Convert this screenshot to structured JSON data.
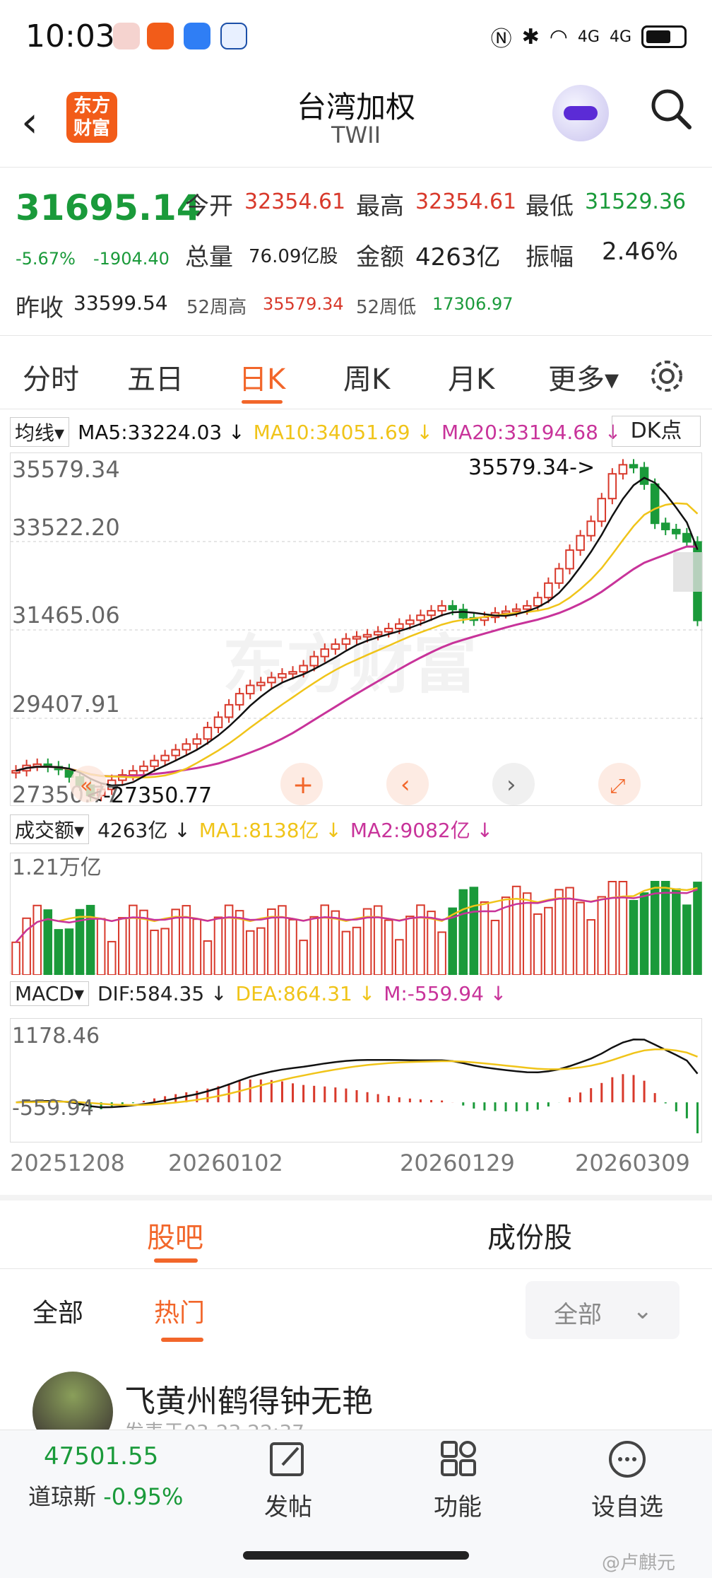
{
  "status_bar": {
    "time": "10:03",
    "signal_a": "4G",
    "signal_b": "4G"
  },
  "header": {
    "logo_line1": "东方",
    "logo_line2": "财富",
    "title": "台湾加权",
    "subtitle": "TWII"
  },
  "quote": {
    "price": "31695.14",
    "change_pct": "-5.67%",
    "change_abs": "-1904.40",
    "open_label": "今开",
    "open_value": "32354.61",
    "high_label": "最高",
    "high_value": "32354.61",
    "low_label": "最低",
    "low_value": "31529.36",
    "volume_label": "总量",
    "volume_value": "76.09亿股",
    "amount_label": "金额",
    "amount_value": "4263亿",
    "amplitude_label": "振幅",
    "amplitude_value": "2.46%",
    "prev_close_label": "昨收",
    "prev_close_value": "33599.54",
    "w52_high_label": "52周高",
    "w52_high_value": "35579.34",
    "w52_low_label": "52周低",
    "w52_low_value": "17306.97"
  },
  "tabs": [
    "分时",
    "五日",
    "日K",
    "周K",
    "月K",
    "更多▾"
  ],
  "active_tab": "日K",
  "ma_row": {
    "selector": "均线",
    "ma5": "MA5:33224.03 ↓",
    "ma10": "MA10:34051.69 ↓",
    "ma20": "MA20:33194.68 ↓",
    "dk_button": "DK点"
  },
  "price_axis": [
    "35579.34",
    "33522.20",
    "31465.06",
    "29407.91",
    "27350.77"
  ],
  "annotations": {
    "high": "35579.34->",
    "low": "<-27350.77"
  },
  "watermark_logo": "东方财富",
  "vol_row": {
    "selector": "成交额",
    "amount": "4263亿 ↓",
    "ma1": "MA1:8138亿 ↓",
    "ma2": "MA2:9082亿 ↓",
    "axis_max": "1.21万亿"
  },
  "macd_row": {
    "selector": "MACD",
    "dif": "DIF:584.35 ↓",
    "dea": "DEA:864.31 ↓",
    "m": "M:-559.94 ↓",
    "axis_max": "1178.46",
    "axis_min": "-559.94"
  },
  "dates": [
    "20251208",
    "20260102",
    "20260129",
    "20260309"
  ],
  "section_tabs": [
    "股吧",
    "成份股"
  ],
  "sub_tabs": [
    "全部",
    "热门"
  ],
  "filter_dropdown": "全部",
  "post": {
    "user": "飞黄州鹤得钟无艳",
    "time": "发表于03-23 22:37"
  },
  "bottom_bar": {
    "index_value": "47501.55",
    "index_name": "道琼斯",
    "index_change": "-0.95%",
    "post_label": "发帖",
    "func_label": "功能",
    "watch_label": "设自选"
  },
  "credit": "@卢麒元",
  "colors": {
    "up": "#d8392b",
    "down": "#1a9a3a",
    "accent": "#f2662a",
    "ma5": "#111111",
    "ma10": "#f0c419",
    "ma20": "#c8339a"
  },
  "chart_data": {
    "type": "candlestick",
    "title": "台湾加权 日K",
    "ylim": [
      27350.77,
      35579.34
    ],
    "candles_close": [
      28050,
      28180,
      28210,
      28150,
      28080,
      27900,
      27700,
      27450,
      27600,
      27820,
      27950,
      28050,
      28160,
      28300,
      28420,
      28560,
      28700,
      28820,
      29100,
      29350,
      29650,
      29920,
      30120,
      30190,
      30310,
      30400,
      30450,
      30600,
      30820,
      31000,
      31120,
      31250,
      31300,
      31350,
      31420,
      31500,
      31610,
      31700,
      31820,
      31930,
      32050,
      31960,
      31760,
      31700,
      31770,
      31880,
      31920,
      31970,
      32050,
      32250,
      32600,
      32950,
      33400,
      33750,
      34100,
      34650,
      35250,
      35470,
      35400,
      35000,
      34050,
      33900,
      33800,
      33600,
      31695
    ],
    "volume_axis_max": "1.21万亿",
    "macd_axis": [
      -559.94,
      1178.46
    ],
    "x_ticks": [
      "20251208",
      "20260102",
      "20260129",
      "20260309"
    ]
  }
}
